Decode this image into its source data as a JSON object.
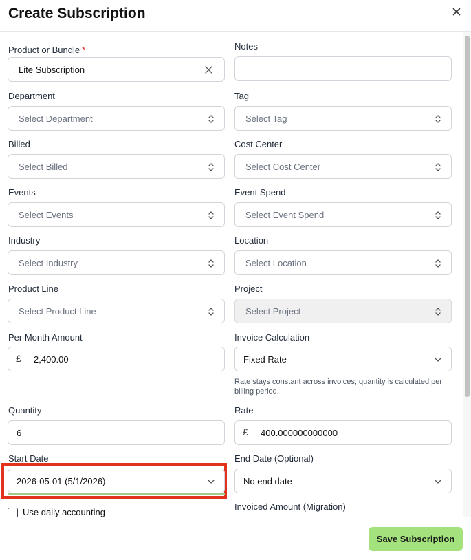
{
  "dialog": {
    "title": "Create Subscription",
    "save_label": "Save Subscription"
  },
  "form": {
    "product": {
      "label": "Product or Bundle",
      "required_mark": "*",
      "value": "Lite Subscription"
    },
    "notes": {
      "label": "Notes",
      "value": ""
    },
    "department": {
      "label": "Department",
      "placeholder": "Select Department"
    },
    "tag": {
      "label": "Tag",
      "placeholder": "Select Tag"
    },
    "billed": {
      "label": "Billed",
      "placeholder": "Select Billed"
    },
    "cost_center": {
      "label": "Cost Center",
      "placeholder": "Select Cost Center"
    },
    "events": {
      "label": "Events",
      "placeholder": "Select Events"
    },
    "event_spend": {
      "label": "Event Spend",
      "placeholder": "Select Event Spend"
    },
    "industry": {
      "label": "Industry",
      "placeholder": "Select Industry"
    },
    "location": {
      "label": "Location",
      "placeholder": "Select Location"
    },
    "product_line": {
      "label": "Product Line",
      "placeholder": "Select Product Line"
    },
    "project": {
      "label": "Project",
      "placeholder": "Select Project",
      "disabled": true
    },
    "per_month_amount": {
      "label": "Per Month Amount",
      "currency": "£",
      "value": "2,400.00"
    },
    "invoice_calculation": {
      "label": "Invoice Calculation",
      "value": "Fixed Rate",
      "hint": "Rate stays constant across invoices; quantity is calculated per billing period."
    },
    "quantity": {
      "label": "Quantity",
      "value": "6"
    },
    "rate": {
      "label": "Rate",
      "currency": "£",
      "value": "400.000000000000"
    },
    "start_date": {
      "label": "Start Date",
      "value": "2026-05-01 (5/1/2026)"
    },
    "end_date": {
      "label": "End Date (Optional)",
      "value": "No end date"
    },
    "daily_accounting": {
      "label": "Use daily accounting",
      "checked": false
    },
    "invoiced_amount": {
      "label": "Invoiced Amount (Migration)"
    }
  },
  "icons": {
    "close": "close-icon",
    "clear": "clear-icon",
    "updown": "updown-chevron-icon",
    "chevron": "chevron-down-icon"
  },
  "colors": {
    "save_button_bg": "#a3e27c",
    "highlight_border": "#e0321d",
    "required": "#dc2626"
  }
}
